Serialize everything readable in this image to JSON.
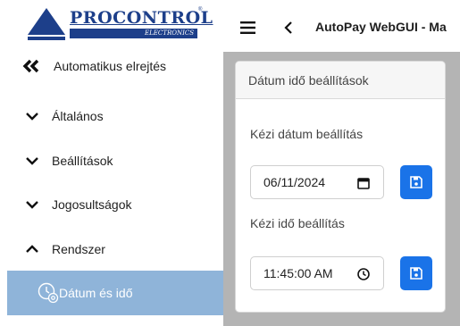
{
  "logo": {
    "brand": "PROCONTROL",
    "subtitle": "ELECTRONICS",
    "reg": "®"
  },
  "topbar": {
    "title": "AutoPay WebGUI - Ma"
  },
  "sidebar": {
    "back_label": "Automatikus elrejtés",
    "items": [
      {
        "label": "Általános",
        "state": "collapsed"
      },
      {
        "label": "Beállítások",
        "state": "collapsed"
      },
      {
        "label": "Jogosultságok",
        "state": "collapsed"
      },
      {
        "label": "Rendszer",
        "state": "expanded"
      }
    ],
    "active_item": {
      "label": "Dátum és idő",
      "icon": "clock-gear-icon"
    }
  },
  "card": {
    "title": "Dátum idő beállítások",
    "date_label": "Kézi dátum beállítás",
    "date_value": "06/11/2024",
    "time_label": "Kézi idő beállítás",
    "time_value": "11:45:00 AM"
  },
  "colors": {
    "accent": "#1a73e8",
    "active_menu": "#8fb4d9",
    "brand": "#1d3f8a",
    "content_bg": "#b4b4b4"
  }
}
